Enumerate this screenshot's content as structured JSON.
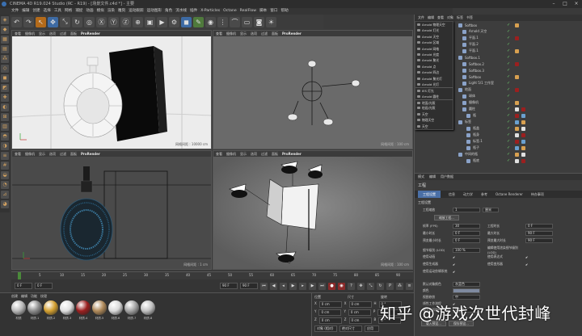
{
  "window": {
    "title": "CINEMA 4D R19.024 Studio (RC - R19) - [场景文件.c4d *] - 主要"
  },
  "menu": {
    "items": [
      "文件",
      "编辑",
      "创建",
      "选择",
      "工具",
      "网格",
      "捕捉",
      "动画",
      "模拟",
      "渲染",
      "雕刻",
      "运动跟踪",
      "运动图形",
      "角色",
      "流水线",
      "插件",
      "X-Particles",
      "Octane",
      "RealFlow",
      "脚本",
      "窗口",
      "帮助"
    ]
  },
  "viewports": [
    {
      "name": "透视视图",
      "menu": [
        "查看",
        "摄像机",
        "显示",
        "选项",
        "过滤",
        "面板"
      ],
      "renderer": "ProRender",
      "footer": "网格间距 : 10000 cm"
    },
    {
      "name": "顶视图",
      "menu": [
        "查看",
        "摄像机",
        "显示",
        "选项",
        "过滤",
        "面板"
      ],
      "renderer": "ProRender",
      "footer": "网格间距 : 100 cm"
    },
    {
      "name": "前视图",
      "menu": [
        "查看",
        "摄像机",
        "显示",
        "选项",
        "过滤",
        "面板"
      ],
      "renderer": "ProRender",
      "footer": "网格间距 : 1 cm"
    },
    {
      "name": "右视图",
      "menu": [
        "查看",
        "摄像机",
        "显示",
        "选项",
        "过滤",
        "面板"
      ],
      "renderer": "ProRender",
      "footer": "网格间距 : 100 cm"
    }
  ],
  "timeline": {
    "ticks": [
      "0",
      "5",
      "10",
      "15",
      "20",
      "25",
      "30",
      "35",
      "40",
      "45",
      "50",
      "55",
      "60",
      "65",
      "70",
      "75",
      "80",
      "85",
      "90"
    ],
    "current_frame": "0 F",
    "start": "0 F",
    "end": "90 F",
    "end2": "90 F"
  },
  "material_manager": {
    "menu": [
      "创建",
      "编辑",
      "功能",
      "纹理"
    ],
    "materials": [
      {
        "label": "材质",
        "color": "#b9b9b9"
      },
      {
        "label": "材质.1",
        "color": "#8d8d8d"
      },
      {
        "label": "材质.2",
        "color": "#d4a030"
      },
      {
        "label": "材质.3",
        "color": "#e0e0e0"
      },
      {
        "label": "材质.4",
        "color": "#9b1f1f"
      },
      {
        "label": "材质.5",
        "color": "#b08a5a"
      },
      {
        "label": "材质.6",
        "color": "#d9d9d9"
      },
      {
        "label": "材质.7",
        "color": "#a3a3a3"
      },
      {
        "label": "材质.8",
        "color": "#c2c2c2"
      }
    ]
  },
  "coordinates": {
    "headers": [
      "位置",
      "尺寸",
      "旋转"
    ],
    "rows": [
      {
        "a": "X",
        "v1": "0 cm",
        "b": "X",
        "v2": "0 cm",
        "c": "H",
        "v3": "0 °"
      },
      {
        "a": "Y",
        "v1": "0 cm",
        "b": "Y",
        "v2": "0 cm",
        "c": "P",
        "v3": "0 °"
      },
      {
        "a": "Z",
        "v1": "0 cm",
        "b": "Z",
        "v2": "0 cm",
        "c": "B",
        "v3": "0 °"
      }
    ],
    "mode": "对象 (相对)",
    "size_mode": "绝对尺寸",
    "apply": "应用"
  },
  "object_manager": {
    "tabs": [
      "文件",
      "编辑",
      "查看",
      "对象",
      "标签",
      "书签"
    ],
    "light_menu": [
      "Arnold 物理天空",
      "Arnold 灯光",
      "Arnold 天空",
      "Arnold 区域",
      "Arnold 网格",
      "Arnold 光度",
      "Arnold 聚光",
      "Arnold 点",
      "Arnold 四边",
      "Arnold 聚光灯",
      "Arnold 光灯",
      "IES 灯光",
      "Arnold 圆柱",
      "地面/光照",
      "绘画/光照",
      "天空",
      "物理天空",
      "天空"
    ],
    "objects": [
      "Softbox",
      "Arnold 天空",
      "平面.1",
      "平面.2",
      "平面.1",
      "Softbox.1",
      "Softbox.2",
      "Softbox.3",
      "Softbox",
      "Light 5/1 工作室",
      "地面",
      "球体",
      "摄像机",
      "圆柱",
      "瓶",
      "标签",
      "瓶盖",
      "瓶身",
      "标签.1",
      "瓶子",
      "中间的瓶",
      "瓶底"
    ]
  },
  "attributes": {
    "tabs": [
      "模式",
      "编辑",
      "用户数据"
    ],
    "title": "工程",
    "subtabs": [
      "工程设置",
      "信息",
      "动力学",
      "参考",
      "Octane Renderer",
      "待办事项"
    ],
    "section": "工程设置",
    "scale_label": "工程缩放",
    "scale_value": "1",
    "scale_unit": "厘米",
    "scale_button": "缩放工程...",
    "fields": [
      {
        "l": "帧率 (FPS)",
        "v": "30",
        "l2": "工程时长",
        "v2": "0 F"
      },
      {
        "l": "最小时长",
        "v": "0 F",
        "l2": "最大时长",
        "v2": "90 F"
      },
      {
        "l": "预览最小时长",
        "v": "0 F",
        "l2": "预览最大时长",
        "v2": "90 F"
      },
      {
        "l": "细节级别 (LOD)",
        "v": "100 %",
        "l2": "编辑使用渲染细节级别 (LOD)",
        "v2": ""
      }
    ],
    "checks": [
      {
        "l": "使用动画",
        "l2": "使用表达式"
      },
      {
        "l": "使用生成器",
        "l2": "使用变形器"
      },
      {
        "l": "使用运动剪辑系统",
        "l2": ""
      }
    ],
    "default_color_label": "默认对象颜色",
    "default_color_value": "灰蓝色",
    "color_label": "颜色",
    "view_clip_label": "视图修剪",
    "view_clip_value": "中",
    "linear_label": "线性工作流程",
    "input_color_label": "输入色彩特性",
    "input_color_value": "sRGB",
    "load_button": "载入预设...",
    "save_button": "保存预设..."
  },
  "watermark": "知乎 @游戏次世代封峰"
}
